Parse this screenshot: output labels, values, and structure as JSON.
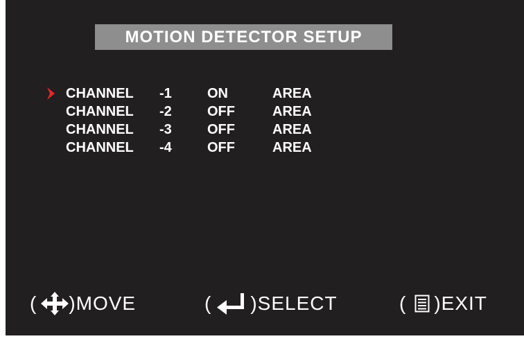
{
  "title": "MOTION DETECTOR SETUP",
  "channels": [
    {
      "label": "CHANNEL",
      "number": "-1",
      "state": "ON",
      "area": "AREA"
    },
    {
      "label": "CHANNEL",
      "number": "-2",
      "state": "OFF",
      "area": "AREA"
    },
    {
      "label": "CHANNEL",
      "number": "-3",
      "state": "OFF",
      "area": "AREA"
    },
    {
      "label": "CHANNEL",
      "number": "-4",
      "state": "OFF",
      "area": "AREA"
    }
  ],
  "selected_row": 1,
  "footer": {
    "open_paren": "(",
    "close_paren": ")",
    "move_label": "MOVE",
    "select_label": "SELECT",
    "exit_label": "EXIT",
    "move_icon": "four-way-arrows-icon",
    "select_icon": "enter-arrow-icon",
    "exit_icon": "menu-list-icon"
  },
  "colors": {
    "background": "#211f20",
    "title_bar": "#8e8e8e",
    "text": "#ffffff",
    "cursor": "#e8262a"
  }
}
